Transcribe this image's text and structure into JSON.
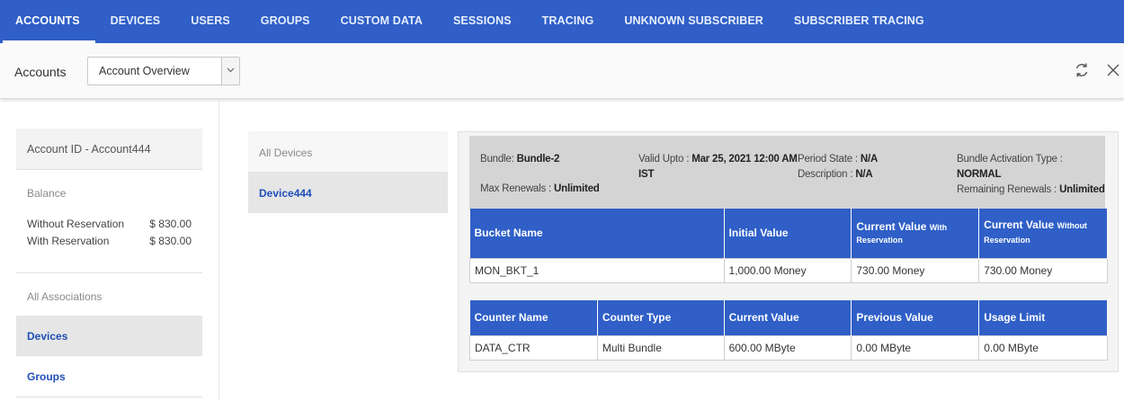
{
  "topnav": {
    "tabs": [
      {
        "label": "ACCOUNTS",
        "active": true
      },
      {
        "label": "DEVICES"
      },
      {
        "label": "USERS"
      },
      {
        "label": "GROUPS"
      },
      {
        "label": "CUSTOM DATA"
      },
      {
        "label": "SESSIONS"
      },
      {
        "label": "TRACING"
      },
      {
        "label": "UNKNOWN SUBSCRIBER"
      },
      {
        "label": "SUBSCRIBER TRACING"
      }
    ]
  },
  "header": {
    "title": "Accounts",
    "view_select": {
      "value": "Account Overview"
    },
    "refresh_icon": "refresh-icon",
    "close_icon": "close-icon"
  },
  "left": {
    "account_id": "Account ID - Account444",
    "balance_label": "Balance",
    "balances": [
      {
        "label": "Without Reservation",
        "amount": "$ 830.00"
      },
      {
        "label": "With Reservation",
        "amount": "$ 830.00"
      }
    ],
    "associations_label": "All Associations",
    "associations": [
      {
        "label": "Devices",
        "active": true
      },
      {
        "label": "Groups"
      }
    ]
  },
  "devices": {
    "header": "All Devices",
    "items": [
      "Device444"
    ]
  },
  "bundle": {
    "bundle_label": "Bundle: ",
    "bundle_value": "Bundle-2",
    "max_renewals_label": "Max Renewals : ",
    "max_renewals_value": "Unlimited",
    "valid_upto_label": "Valid Upto : ",
    "valid_upto_value_1": "Mar 25, 2021 12:00 AM",
    "valid_upto_value_2": "IST",
    "period_state_label": "Period State : ",
    "period_state_value": "N/A",
    "description_label": "Description : ",
    "description_value": "N/A",
    "activation_type_label": "Bundle Activation Type : ",
    "activation_type_value": "NORMAL",
    "remaining_renewals_label": "Remaining Renewals : ",
    "remaining_renewals_value": "Unlimited"
  },
  "buckets": {
    "headers": {
      "name": "Bucket Name",
      "initial": "Initial Value",
      "current_with": "Current Value",
      "current_with_small": "With Reservation",
      "current_without": "Current Value",
      "current_without_small": "Without Reservation"
    },
    "rows": [
      {
        "name": "MON_BKT_1",
        "initial": "1,000.00 Money",
        "current_with": "730.00 Money",
        "current_without": "730.00 Money"
      }
    ]
  },
  "counters": {
    "headers": [
      "Counter Name",
      "Counter Type",
      "Current Value",
      "Previous Value",
      "Usage Limit"
    ],
    "rows": [
      [
        "DATA_CTR",
        "Multi Bundle",
        "600.00 MByte",
        "0.00 MByte",
        "0.00 MByte"
      ]
    ]
  }
}
